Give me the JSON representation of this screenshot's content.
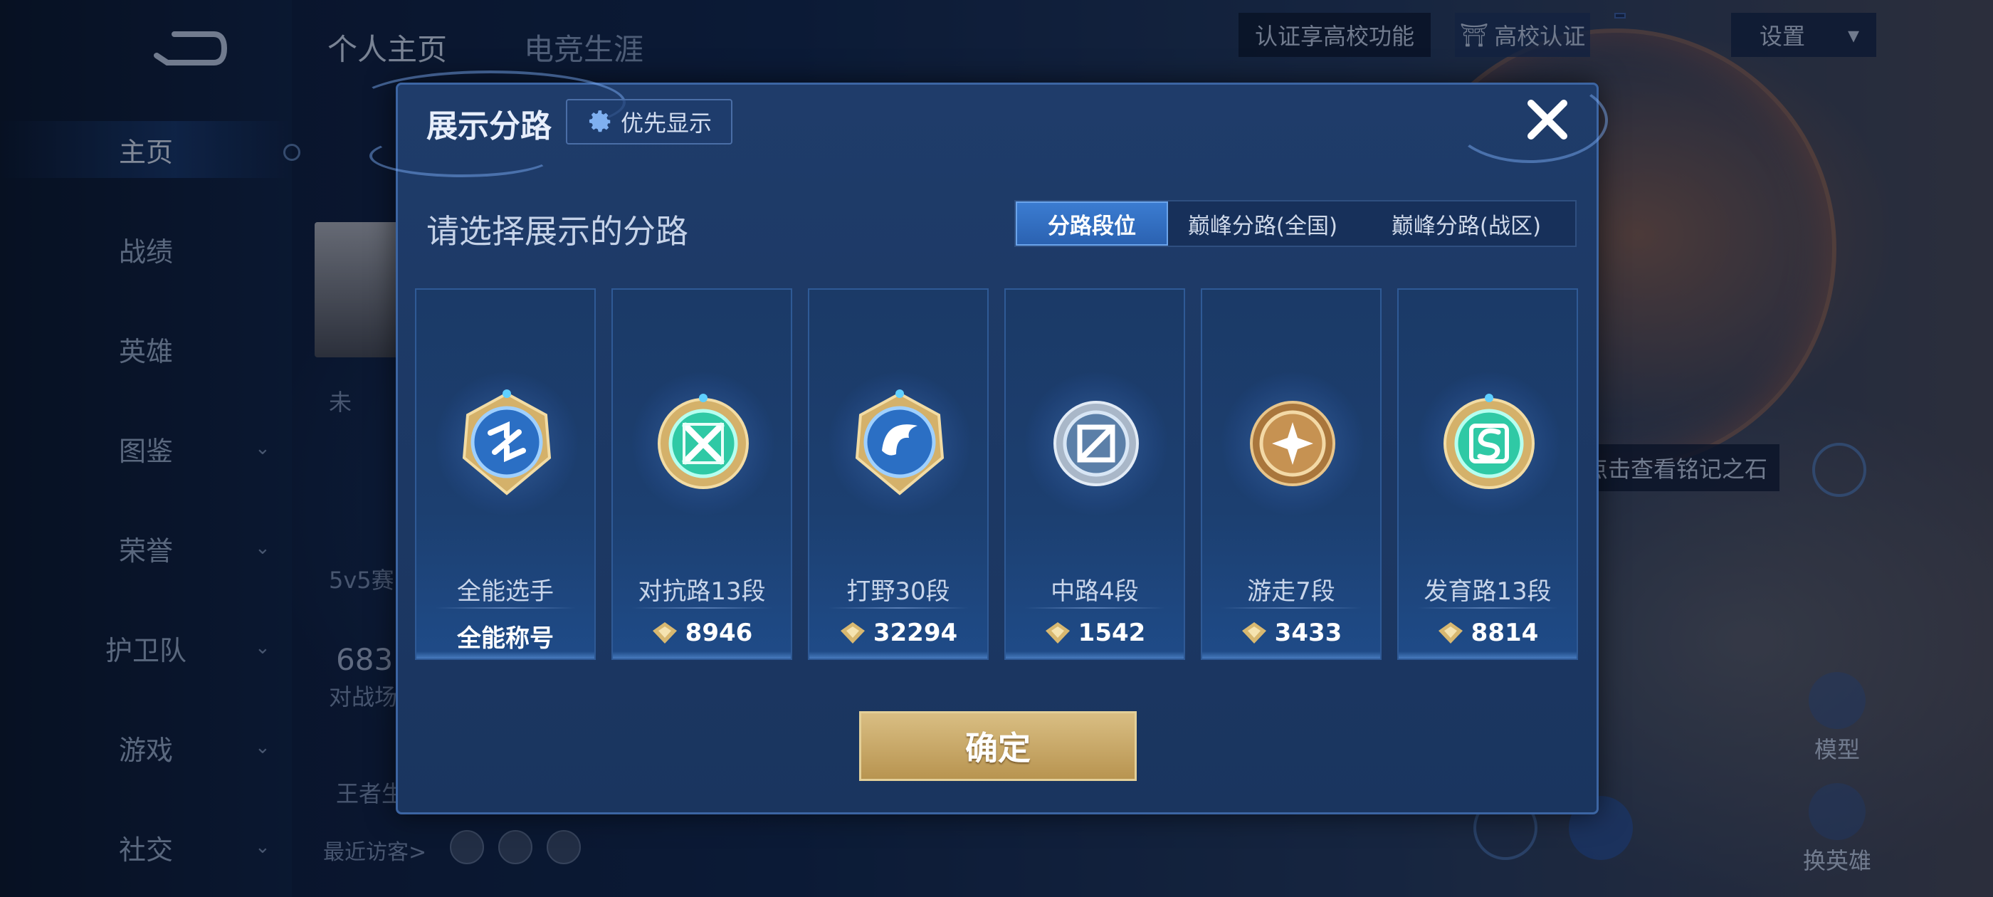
{
  "sidebar": {
    "items": [
      {
        "label": "主页",
        "active": true,
        "chevron": false
      },
      {
        "label": "战绩",
        "active": false,
        "chevron": false
      },
      {
        "label": "英雄",
        "active": false,
        "chevron": false
      },
      {
        "label": "图鉴",
        "active": false,
        "chevron": true
      },
      {
        "label": "荣誉",
        "active": false,
        "chevron": true
      },
      {
        "label": "护卫队",
        "active": false,
        "chevron": true
      },
      {
        "label": "游戏",
        "active": false,
        "chevron": true
      },
      {
        "label": "社交",
        "active": false,
        "chevron": true
      }
    ]
  },
  "top_tabs": [
    "个人主页",
    "电竞生涯"
  ],
  "top_right": {
    "verify_tip": "认证享高校功能",
    "verify_button": "高校认证",
    "settings": "设置"
  },
  "profile_bg": {
    "snippet_status": "未",
    "snippet_mode": "5v5赛",
    "snippet_count": "683",
    "snippet_count_label": "对战场",
    "snippet_king": "王者生",
    "recent_visitors": "最近访客>"
  },
  "right_panel": {
    "inscription_tip": "点击查看铭记之石",
    "model_label": "模型",
    "change_hero_label": "换英雄"
  },
  "modal": {
    "title": "展示分路",
    "priority_button": "优先显示",
    "subtitle": "请选择展示的分路",
    "segments": [
      "分路段位",
      "巅峰分路(全国)",
      "巅峰分路(战区)"
    ],
    "selected_segment": "分路段位",
    "lanes": [
      {
        "name": "全能选手",
        "value": "全能称号",
        "has_points_icon": false,
        "icon": "all-round-badge-icon"
      },
      {
        "name": "对抗路13段",
        "value": "8946",
        "has_points_icon": true,
        "icon": "clash-lane-badge-icon"
      },
      {
        "name": "打野30段",
        "value": "32294",
        "has_points_icon": true,
        "icon": "jungle-badge-icon"
      },
      {
        "name": "中路4段",
        "value": "1542",
        "has_points_icon": true,
        "icon": "mid-lane-badge-icon"
      },
      {
        "name": "游走7段",
        "value": "3433",
        "has_points_icon": true,
        "icon": "roam-badge-icon"
      },
      {
        "name": "发育路13段",
        "value": "8814",
        "has_points_icon": true,
        "icon": "farm-lane-badge-icon"
      }
    ],
    "confirm_button": "确定"
  },
  "colors": {
    "accent_blue": "#3b7cd1",
    "gold": "#d9be83",
    "teal": "#3fd6b4"
  }
}
